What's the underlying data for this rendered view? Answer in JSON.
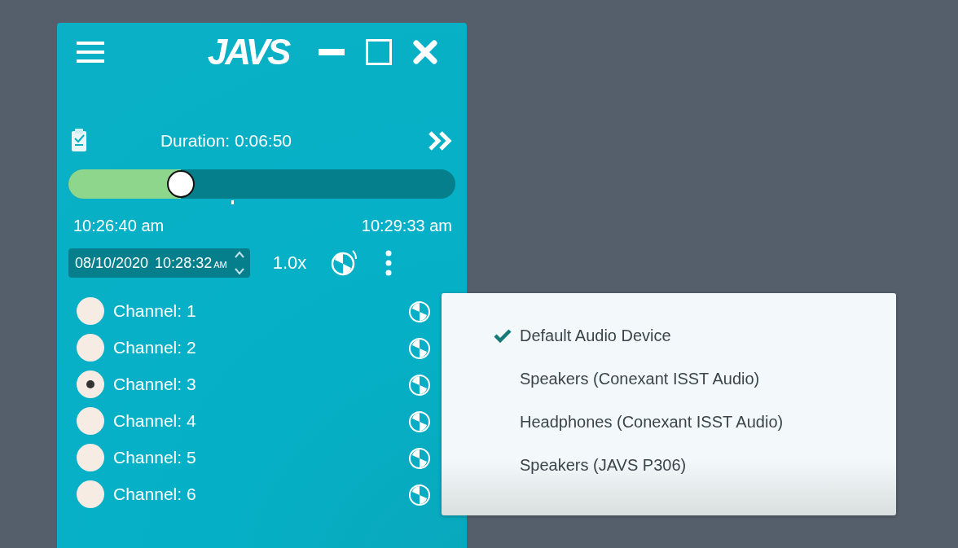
{
  "window": {
    "logo": "JAVS"
  },
  "player": {
    "duration": "Duration: 0:06:50",
    "level": 0.29,
    "start_time": "10:26:40 am",
    "end_time": "10:29:33 am"
  },
  "datetime_field": {
    "date": "08/10/2020",
    "time": "10:28:32",
    "meridiem": "AM"
  },
  "speed": "1.0x",
  "channels": [
    {
      "name": "Channel: 1",
      "selected": false
    },
    {
      "name": "Channel: 2",
      "selected": false
    },
    {
      "name": "Channel: 3",
      "selected": true
    },
    {
      "name": "Channel: 4",
      "selected": false
    },
    {
      "name": "Channel: 5",
      "selected": false
    },
    {
      "name": "Channel: 6",
      "selected": false
    }
  ],
  "audio_menu": [
    {
      "label": "Default Audio Device",
      "checked": true
    },
    {
      "label": "Speakers (Conexant ISST Audio)",
      "checked": false
    },
    {
      "label": "Headphones (Conexant ISST Audio)",
      "checked": false
    },
    {
      "label": "Speakers (JAVS P306)",
      "checked": false
    }
  ]
}
